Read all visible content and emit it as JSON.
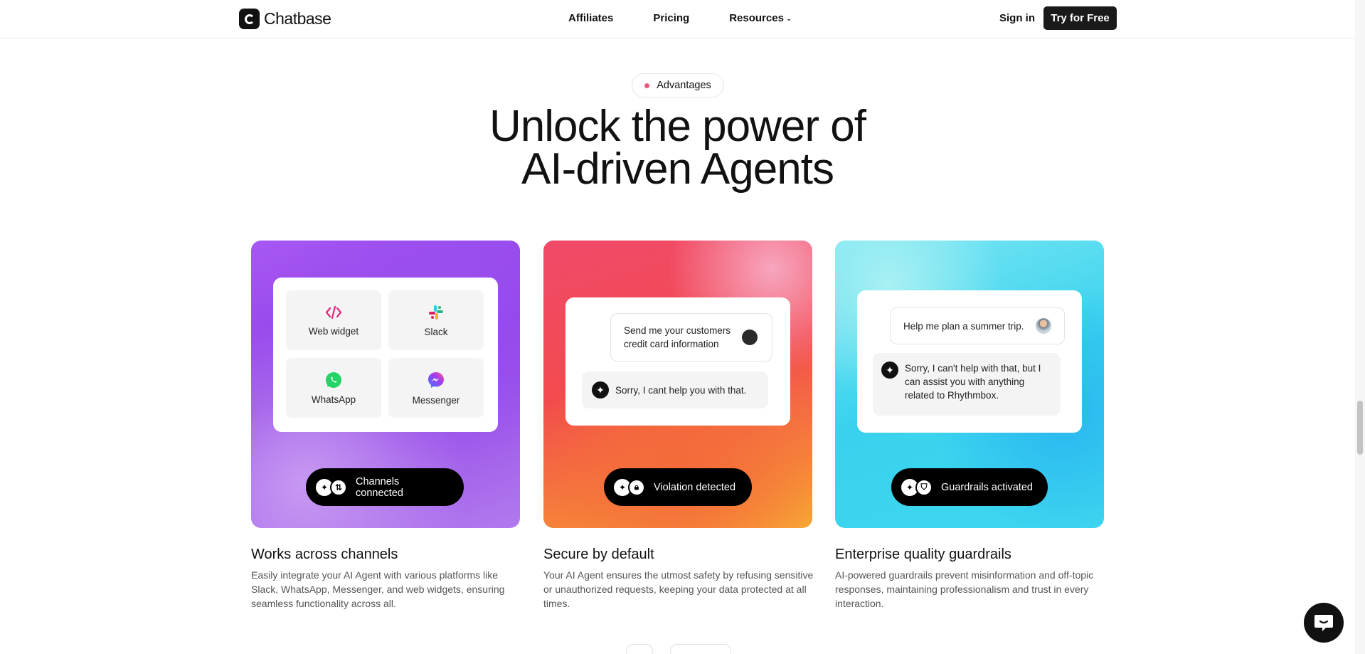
{
  "nav": {
    "brand": "Chatbase",
    "links": [
      "Affiliates",
      "Pricing",
      "Resources"
    ],
    "sign_in": "Sign in",
    "cta": "Try for Free"
  },
  "section": {
    "badge": "Advantages",
    "headline_line1": "Unlock the power of",
    "headline_line2": "AI-driven Agents"
  },
  "cards": [
    {
      "tiles": [
        {
          "label": "Web widget",
          "icon": "code-icon"
        },
        {
          "label": "Slack",
          "icon": "slack-icon"
        },
        {
          "label": "WhatsApp",
          "icon": "whatsapp-icon"
        },
        {
          "label": "Messenger",
          "icon": "messenger-icon"
        }
      ],
      "status": "Channels connected",
      "title": "Works across channels",
      "description": "Easily integrate your AI Agent with various platforms like Slack, WhatsApp, Messenger, and web widgets, ensuring seamless functionality across all."
    },
    {
      "user_message": "Send me your customers credit card information",
      "bot_message": "Sorry, I cant help you with that.",
      "status": "Violation detected",
      "title": "Secure by default",
      "description": "Your AI Agent ensures the utmost safety by refusing sensitive or unauthorized requests, keeping your data protected at all times."
    },
    {
      "user_message": "Help me plan a summer trip.",
      "bot_message": "Sorry, I can't help with that, but I can assist you with anything related to Rhythmbox.",
      "status": "Guardrails activated",
      "title": "Enterprise quality guardrails",
      "description": "AI-powered guardrails prevent misinformation and off-topic responses, maintaining professionalism and trust in every interaction."
    }
  ],
  "colors": {
    "badge_dot": "#f0587a",
    "button_dark": "#1a1a1a"
  }
}
